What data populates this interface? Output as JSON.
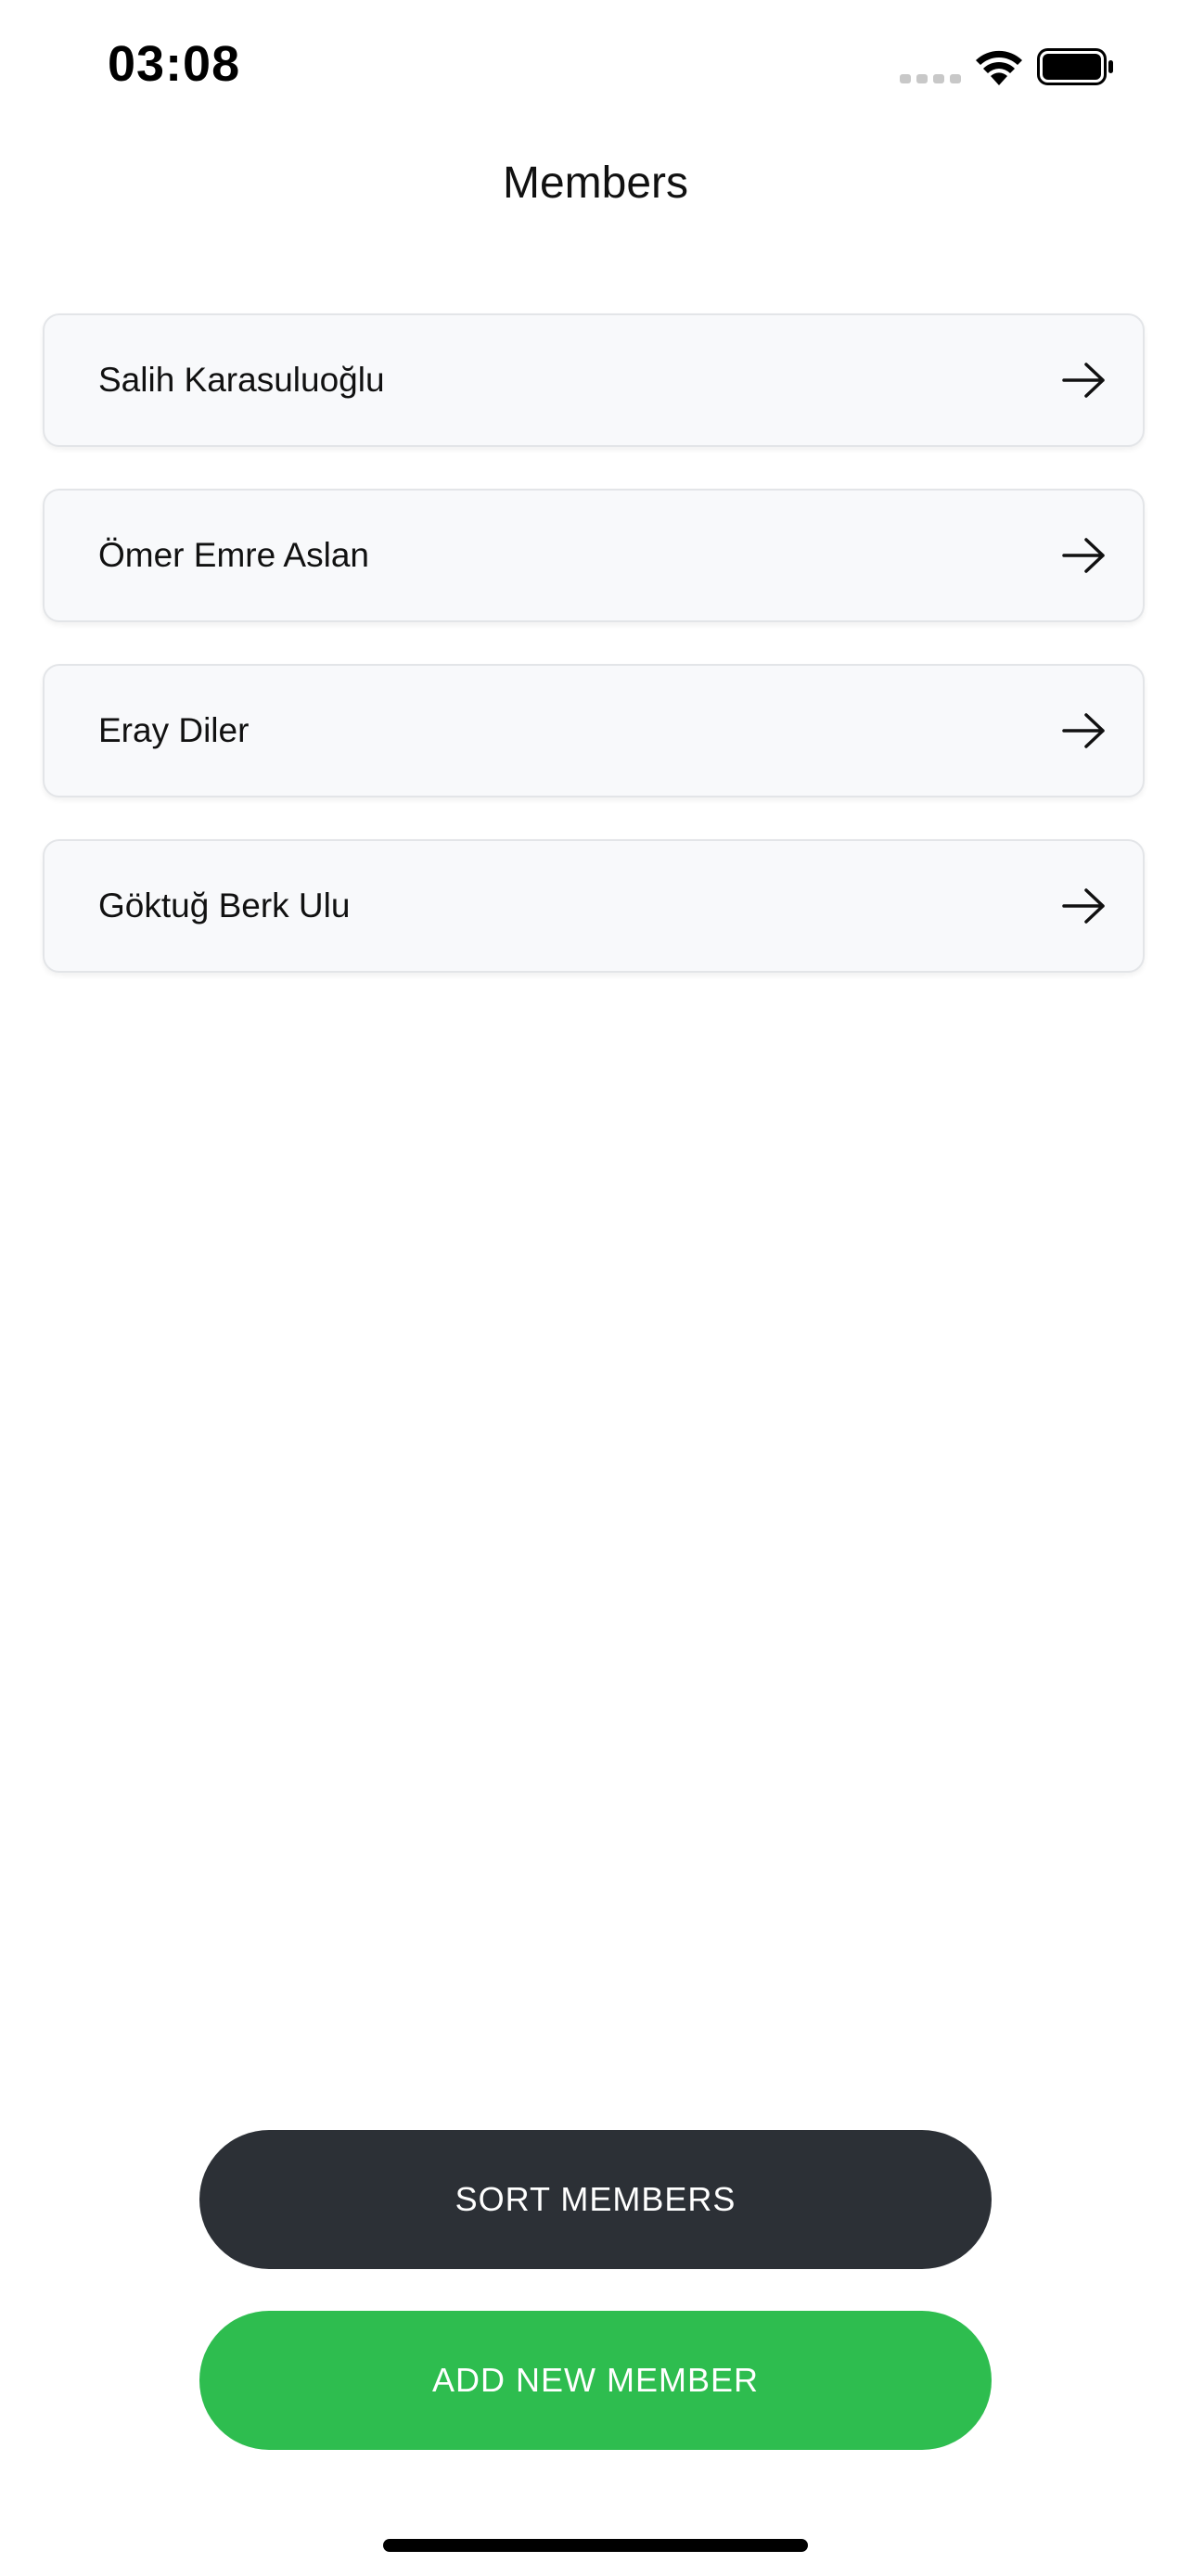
{
  "status_bar": {
    "time": "03:08",
    "signal_icon": "cellular-signal-icon",
    "wifi_icon": "wifi-icon",
    "battery_icon": "battery-icon"
  },
  "header": {
    "title": "Members"
  },
  "members": [
    {
      "name": "Salih Karasuluoğlu",
      "icon": "arrow-right-icon"
    },
    {
      "name": "Ömer Emre Aslan",
      "icon": "arrow-right-icon"
    },
    {
      "name": "Eray Diler",
      "icon": "arrow-right-icon"
    },
    {
      "name": "Göktuğ Berk Ulu",
      "icon": "arrow-right-icon"
    }
  ],
  "actions": {
    "sort_label": "SORT MEMBERS",
    "add_label": "ADD NEW MEMBER"
  },
  "colors": {
    "sort_button": "#2c3036",
    "add_button": "#2ebd4f",
    "card_background": "#f8f9fb",
    "card_border": "#e3e5e8"
  }
}
